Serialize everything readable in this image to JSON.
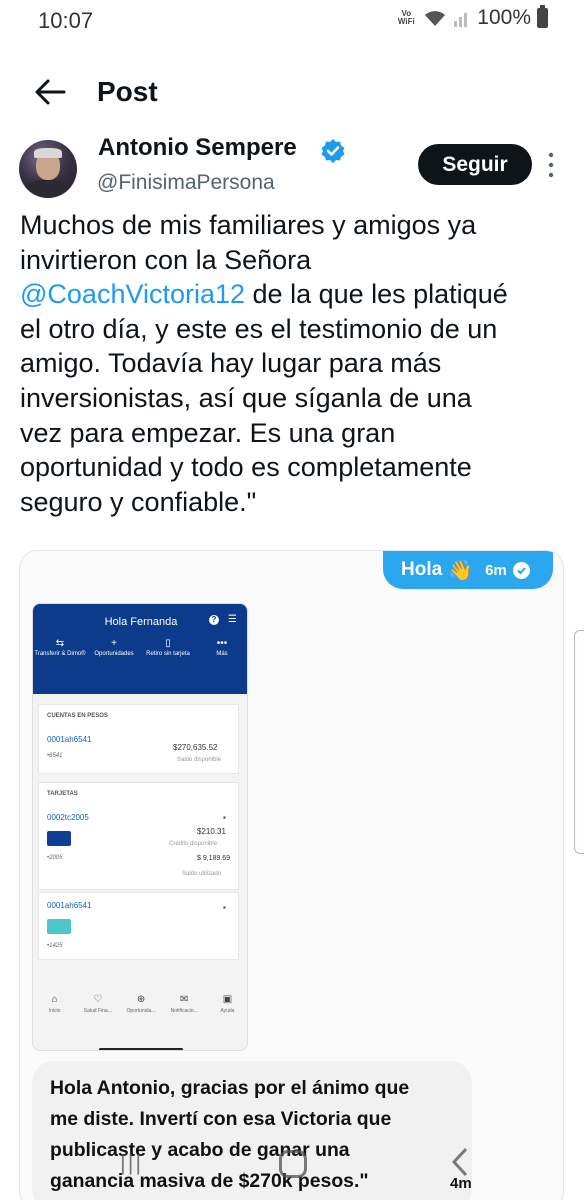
{
  "status_bar": {
    "time": "10:07",
    "network": "Vo\nWiFi",
    "battery": "100%"
  },
  "header": {
    "title": "Post"
  },
  "author": {
    "name": "Antonio Sempere",
    "handle": "@FinisimaPersona",
    "follow_label": "Seguir",
    "verified": true
  },
  "post": {
    "lines": [
      {
        "pre": "Muchos de mis familiares y amigos ya",
        "mention": "",
        "post": ""
      },
      {
        "pre": "invirtieron con la Señora",
        "mention": "",
        "post": ""
      },
      {
        "pre": "",
        "mention": "@CoachVictoria12",
        "post": " de la que les platiqué"
      },
      {
        "pre": "el otro día, y este es el testimonio de un",
        "mention": "",
        "post": ""
      },
      {
        "pre": "amigo. Todavía hay lugar para más",
        "mention": "",
        "post": ""
      },
      {
        "pre": "inversionistas, así que síganla de una",
        "mention": "",
        "post": ""
      },
      {
        "pre": "vez para empezar. Es una gran",
        "mention": "",
        "post": ""
      },
      {
        "pre": "oportunidad y todo es completamente",
        "mention": "",
        "post": ""
      },
      {
        "pre": "seguro y confiable.\"",
        "mention": "",
        "post": ""
      }
    ]
  },
  "media": {
    "hola_bubble": {
      "text": "Hola",
      "emoji": "👋",
      "time": "6m"
    },
    "bank_app": {
      "greeting": "Hola Fernanda",
      "actions": [
        {
          "glyph": "⇆",
          "label": "Transferir & Dimo®"
        },
        {
          "glyph": "+",
          "label": "Oportunidades"
        },
        {
          "glyph": "▯",
          "label": "Retiro sin tarjeta"
        },
        {
          "glyph": "•••",
          "label": "Más"
        }
      ],
      "accounts_heading": "CUENTAS EN PESOS",
      "account": {
        "id": "0001ah6541",
        "suffix": "•6541",
        "balance": "$270,635.52",
        "balance_caption": "Saldo disponible"
      },
      "cards_heading": "TARJETAS",
      "card1": {
        "id": "0002tc2005",
        "suffix": "•2005",
        "credit": "$210.31",
        "credit_caption": "Crédito disponible",
        "used": "$ 9,189.69",
        "used_caption": "Saldo utilizado"
      },
      "card2": {
        "id": "0001ah6541",
        "suffix": "•1425"
      },
      "nav": [
        {
          "glyph": "⌂",
          "label": "Inicio"
        },
        {
          "glyph": "♡",
          "label": "Salud Fina..."
        },
        {
          "glyph": "⊕",
          "label": "Oportunida..."
        },
        {
          "glyph": "✉",
          "label": "Notificacio..."
        },
        {
          "glyph": "▣",
          "label": "Ayuda"
        }
      ]
    },
    "reply": {
      "lines": [
        "Hola Antonio, gracias por el ánimo que",
        "me diste. Invertí con esa Victoria que",
        "publicaste y acabo de ganar una",
        "ganancia masiva de $270k pesos.\""
      ],
      "time": "4m"
    }
  },
  "colors": {
    "accent": "#1d9bf0",
    "bank_blue": "#0b3b8a",
    "chat_blue": "#2aa7ee"
  }
}
